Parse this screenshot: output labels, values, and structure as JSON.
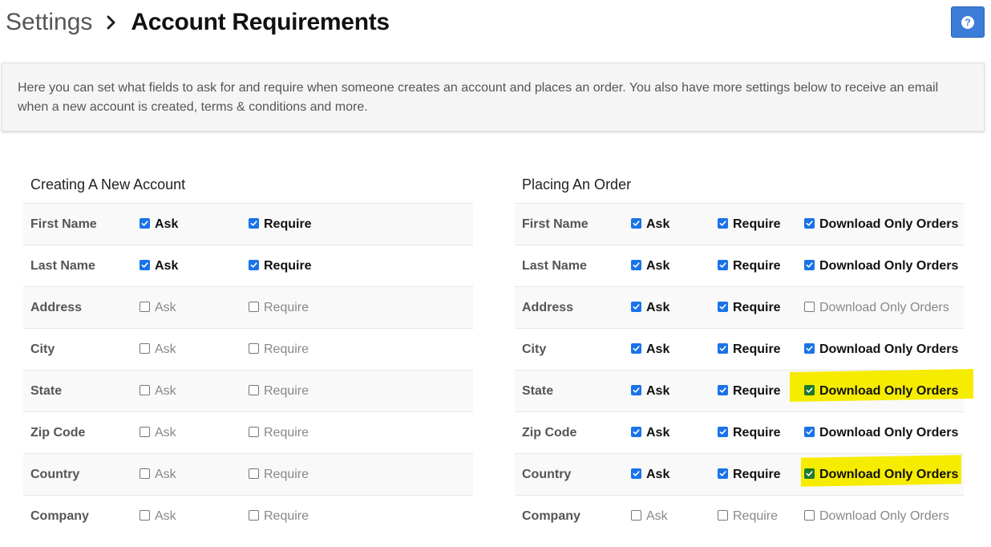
{
  "breadcrumb": {
    "root": "Settings",
    "current": "Account Requirements"
  },
  "help_button": {
    "icon": "question-circle-icon",
    "label": "?"
  },
  "info_text": "Here you can set what fields to ask for and require when someone creates an account and places an order. You also have more settings below to receive an email when a new account is created, terms & conditions and more.",
  "labels": {
    "ask": "Ask",
    "require": "Require",
    "download": "Download Only Orders"
  },
  "colors": {
    "checked": "#1a73e8",
    "highlight": "#f6ec00",
    "help_button": "#3b7dd8"
  },
  "new_account": {
    "title": "Creating A New Account",
    "rows": [
      {
        "field": "First Name",
        "ask": true,
        "require": true
      },
      {
        "field": "Last Name",
        "ask": true,
        "require": true
      },
      {
        "field": "Address",
        "ask": false,
        "require": false
      },
      {
        "field": "City",
        "ask": false,
        "require": false
      },
      {
        "field": "State",
        "ask": false,
        "require": false
      },
      {
        "field": "Zip Code",
        "ask": false,
        "require": false
      },
      {
        "field": "Country",
        "ask": false,
        "require": false
      },
      {
        "field": "Company",
        "ask": false,
        "require": false
      }
    ]
  },
  "placing_order": {
    "title": "Placing An Order",
    "rows": [
      {
        "field": "First Name",
        "ask": true,
        "require": true,
        "download": true,
        "highlighted": false
      },
      {
        "field": "Last Name",
        "ask": true,
        "require": true,
        "download": true,
        "highlighted": false
      },
      {
        "field": "Address",
        "ask": true,
        "require": true,
        "download": false,
        "highlighted": false
      },
      {
        "field": "City",
        "ask": true,
        "require": true,
        "download": true,
        "highlighted": false
      },
      {
        "field": "State",
        "ask": true,
        "require": true,
        "download": true,
        "highlighted": true
      },
      {
        "field": "Zip Code",
        "ask": true,
        "require": true,
        "download": true,
        "highlighted": false
      },
      {
        "field": "Country",
        "ask": true,
        "require": true,
        "download": true,
        "highlighted": true
      },
      {
        "field": "Company",
        "ask": false,
        "require": false,
        "download": false,
        "highlighted": false
      }
    ]
  }
}
